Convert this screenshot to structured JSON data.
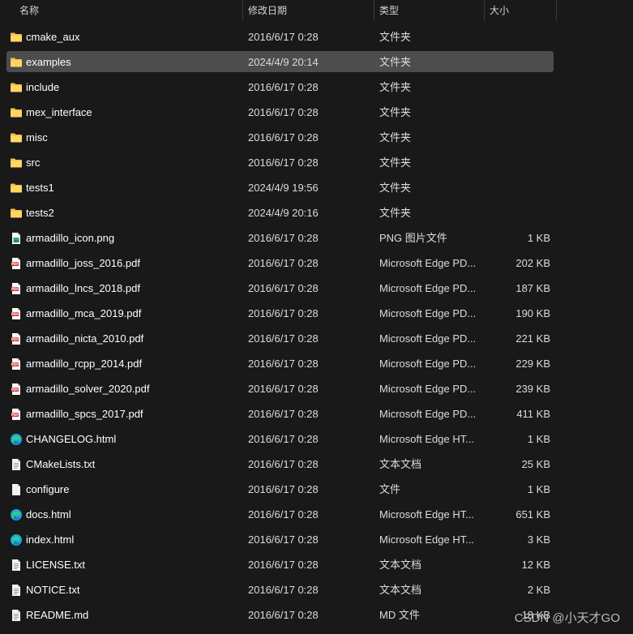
{
  "header": {
    "name": "名称",
    "date": "修改日期",
    "type": "类型",
    "size": "大小",
    "sort_indicator": "^"
  },
  "files": [
    {
      "name": "cmake_aux",
      "date": "2016/6/17 0:28",
      "type": "文件夹",
      "size": "",
      "icon": "folder-icon"
    },
    {
      "name": "examples",
      "date": "2024/4/9 20:14",
      "type": "文件夹",
      "size": "",
      "icon": "folder-icon",
      "selected": true
    },
    {
      "name": "include",
      "date": "2016/6/17 0:28",
      "type": "文件夹",
      "size": "",
      "icon": "folder-icon"
    },
    {
      "name": "mex_interface",
      "date": "2016/6/17 0:28",
      "type": "文件夹",
      "size": "",
      "icon": "folder-icon"
    },
    {
      "name": "misc",
      "date": "2016/6/17 0:28",
      "type": "文件夹",
      "size": "",
      "icon": "folder-icon"
    },
    {
      "name": "src",
      "date": "2016/6/17 0:28",
      "type": "文件夹",
      "size": "",
      "icon": "folder-icon"
    },
    {
      "name": "tests1",
      "date": "2024/4/9 19:56",
      "type": "文件夹",
      "size": "",
      "icon": "folder-icon"
    },
    {
      "name": "tests2",
      "date": "2024/4/9 20:16",
      "type": "文件夹",
      "size": "",
      "icon": "folder-icon"
    },
    {
      "name": "armadillo_icon.png",
      "date": "2016/6/17 0:28",
      "type": "PNG 图片文件",
      "size": "1 KB",
      "icon": "image-file-icon"
    },
    {
      "name": "armadillo_joss_2016.pdf",
      "date": "2016/6/17 0:28",
      "type": "Microsoft Edge PD...",
      "size": "202 KB",
      "icon": "pdf-file-icon"
    },
    {
      "name": "armadillo_lncs_2018.pdf",
      "date": "2016/6/17 0:28",
      "type": "Microsoft Edge PD...",
      "size": "187 KB",
      "icon": "pdf-file-icon"
    },
    {
      "name": "armadillo_mca_2019.pdf",
      "date": "2016/6/17 0:28",
      "type": "Microsoft Edge PD...",
      "size": "190 KB",
      "icon": "pdf-file-icon"
    },
    {
      "name": "armadillo_nicta_2010.pdf",
      "date": "2016/6/17 0:28",
      "type": "Microsoft Edge PD...",
      "size": "221 KB",
      "icon": "pdf-file-icon"
    },
    {
      "name": "armadillo_rcpp_2014.pdf",
      "date": "2016/6/17 0:28",
      "type": "Microsoft Edge PD...",
      "size": "229 KB",
      "icon": "pdf-file-icon"
    },
    {
      "name": "armadillo_solver_2020.pdf",
      "date": "2016/6/17 0:28",
      "type": "Microsoft Edge PD...",
      "size": "239 KB",
      "icon": "pdf-file-icon"
    },
    {
      "name": "armadillo_spcs_2017.pdf",
      "date": "2016/6/17 0:28",
      "type": "Microsoft Edge PD...",
      "size": "411 KB",
      "icon": "pdf-file-icon"
    },
    {
      "name": "CHANGELOG.html",
      "date": "2016/6/17 0:28",
      "type": "Microsoft Edge HT...",
      "size": "1 KB",
      "icon": "edge-html-icon"
    },
    {
      "name": "CMakeLists.txt",
      "date": "2016/6/17 0:28",
      "type": "文本文档",
      "size": "25 KB",
      "icon": "text-file-icon"
    },
    {
      "name": "configure",
      "date": "2016/6/17 0:28",
      "type": "文件",
      "size": "1 KB",
      "icon": "blank-file-icon"
    },
    {
      "name": "docs.html",
      "date": "2016/6/17 0:28",
      "type": "Microsoft Edge HT...",
      "size": "651 KB",
      "icon": "edge-html-icon"
    },
    {
      "name": "index.html",
      "date": "2016/6/17 0:28",
      "type": "Microsoft Edge HT...",
      "size": "3 KB",
      "icon": "edge-html-icon"
    },
    {
      "name": "LICENSE.txt",
      "date": "2016/6/17 0:28",
      "type": "文本文档",
      "size": "12 KB",
      "icon": "text-file-icon"
    },
    {
      "name": "NOTICE.txt",
      "date": "2016/6/17 0:28",
      "type": "文本文档",
      "size": "2 KB",
      "icon": "text-file-icon"
    },
    {
      "name": "README.md",
      "date": "2016/6/17 0:28",
      "type": "MD 文件",
      "size": "18 KB",
      "icon": "text-file-icon"
    }
  ],
  "watermark": "CSDN @小天才GO",
  "colors": {
    "background": "#191919",
    "selection": "#4d4d4d",
    "folder": "#f0c34a",
    "pdf": "#d42a2a",
    "edge": "#1fa0e8"
  }
}
